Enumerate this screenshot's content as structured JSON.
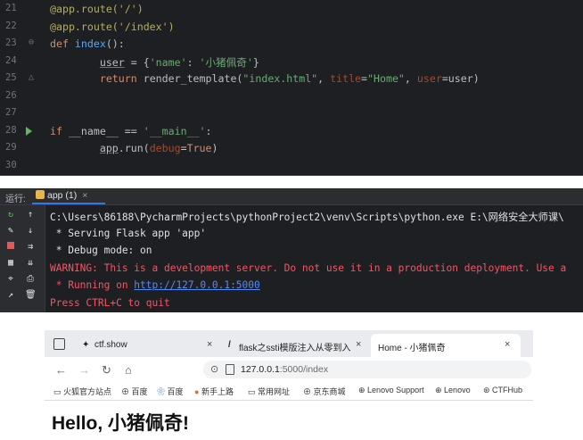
{
  "editor": {
    "lines": [
      {
        "num": "21",
        "parts": [
          {
            "t": "@app.route('/')",
            "c": "dec"
          }
        ]
      },
      {
        "num": "22",
        "parts": [
          {
            "t": "@app.route('/index')",
            "c": "dec"
          }
        ]
      },
      {
        "num": "23",
        "parts": [
          {
            "t": "def ",
            "c": "kw"
          },
          {
            "t": "index",
            "c": "fn"
          },
          {
            "t": "():",
            "c": "ident"
          }
        ]
      },
      {
        "num": "24",
        "parts": [
          {
            "t": "        ",
            "c": "ident"
          },
          {
            "t": "user",
            "c": "ident under"
          },
          {
            "t": " = {",
            "c": "ident"
          },
          {
            "t": "'name'",
            "c": "str"
          },
          {
            "t": ": ",
            "c": "ident"
          },
          {
            "t": "'小猪佩奇'",
            "c": "str"
          },
          {
            "t": "}",
            "c": "ident"
          }
        ]
      },
      {
        "num": "25",
        "parts": [
          {
            "t": "        ",
            "c": "ident"
          },
          {
            "t": "return ",
            "c": "kw"
          },
          {
            "t": "render_template(",
            "c": "ident"
          },
          {
            "t": "\"index.html\"",
            "c": "str"
          },
          {
            "t": ", ",
            "c": "ident"
          },
          {
            "t": "title",
            "c": "param"
          },
          {
            "t": "=",
            "c": "ident"
          },
          {
            "t": "\"Home\"",
            "c": "str"
          },
          {
            "t": ", ",
            "c": "ident"
          },
          {
            "t": "user",
            "c": "param"
          },
          {
            "t": "=user)",
            "c": "ident"
          }
        ]
      },
      {
        "num": "26",
        "parts": []
      },
      {
        "num": "27",
        "parts": []
      },
      {
        "num": "28",
        "parts": [
          {
            "t": "if ",
            "c": "kw"
          },
          {
            "t": "__name__ == ",
            "c": "ident"
          },
          {
            "t": "'__main__'",
            "c": "str"
          },
          {
            "t": ":",
            "c": "ident"
          }
        ]
      },
      {
        "num": "29",
        "parts": [
          {
            "t": "        ",
            "c": "ident"
          },
          {
            "t": "app",
            "c": "ident under"
          },
          {
            "t": ".run(",
            "c": "ident"
          },
          {
            "t": "debug",
            "c": "param"
          },
          {
            "t": "=",
            "c": "ident"
          },
          {
            "t": "True",
            "c": "kw"
          },
          {
            "t": ")",
            "c": "ident"
          }
        ]
      },
      {
        "num": "30",
        "parts": []
      }
    ]
  },
  "run_panel": {
    "label": "运行:",
    "tab_label": "app (1)",
    "tab_close": "×",
    "output": [
      {
        "text": "C:\\Users\\86188\\PycharmProjects\\pythonProject2\\venv\\Scripts\\python.exe E:\\网络安全大师课\\",
        "style": "gray"
      },
      {
        "text": " * Serving Flask app 'app'",
        "style": "gray"
      },
      {
        "text": " * Debug mode: on",
        "style": "gray"
      },
      {
        "text": "WARNING: This is a development server. Do not use it in a production deployment. Use a",
        "style": "red"
      },
      {
        "text": " * Running on ",
        "style": "red",
        "link": "http://127.0.0.1:5000"
      },
      {
        "text": "Press CTRL+C to quit",
        "style": "red"
      }
    ]
  },
  "browser": {
    "tabs": [
      {
        "title": "ctf.show",
        "close": "×"
      },
      {
        "title": "flask之ssti模版注入从零到入门",
        "close": "×"
      },
      {
        "title": "Home - 小猪佩奇",
        "close": "×"
      }
    ],
    "url_host": "127.0.0.1",
    "url_path": ":5000/index",
    "bookmarks": [
      "火狐官方站点",
      "百度",
      "百度",
      "新手上路",
      "常用网址",
      "京东商城",
      "Lenovo Support",
      "Lenovo",
      "CTFHub"
    ],
    "page_heading": "Hello, 小猪佩奇!"
  },
  "colors": {
    "editor_bg": "#1e1f22",
    "accent_blue": "#3574f0",
    "error_red": "#f75464",
    "string_green": "#6aab73"
  }
}
